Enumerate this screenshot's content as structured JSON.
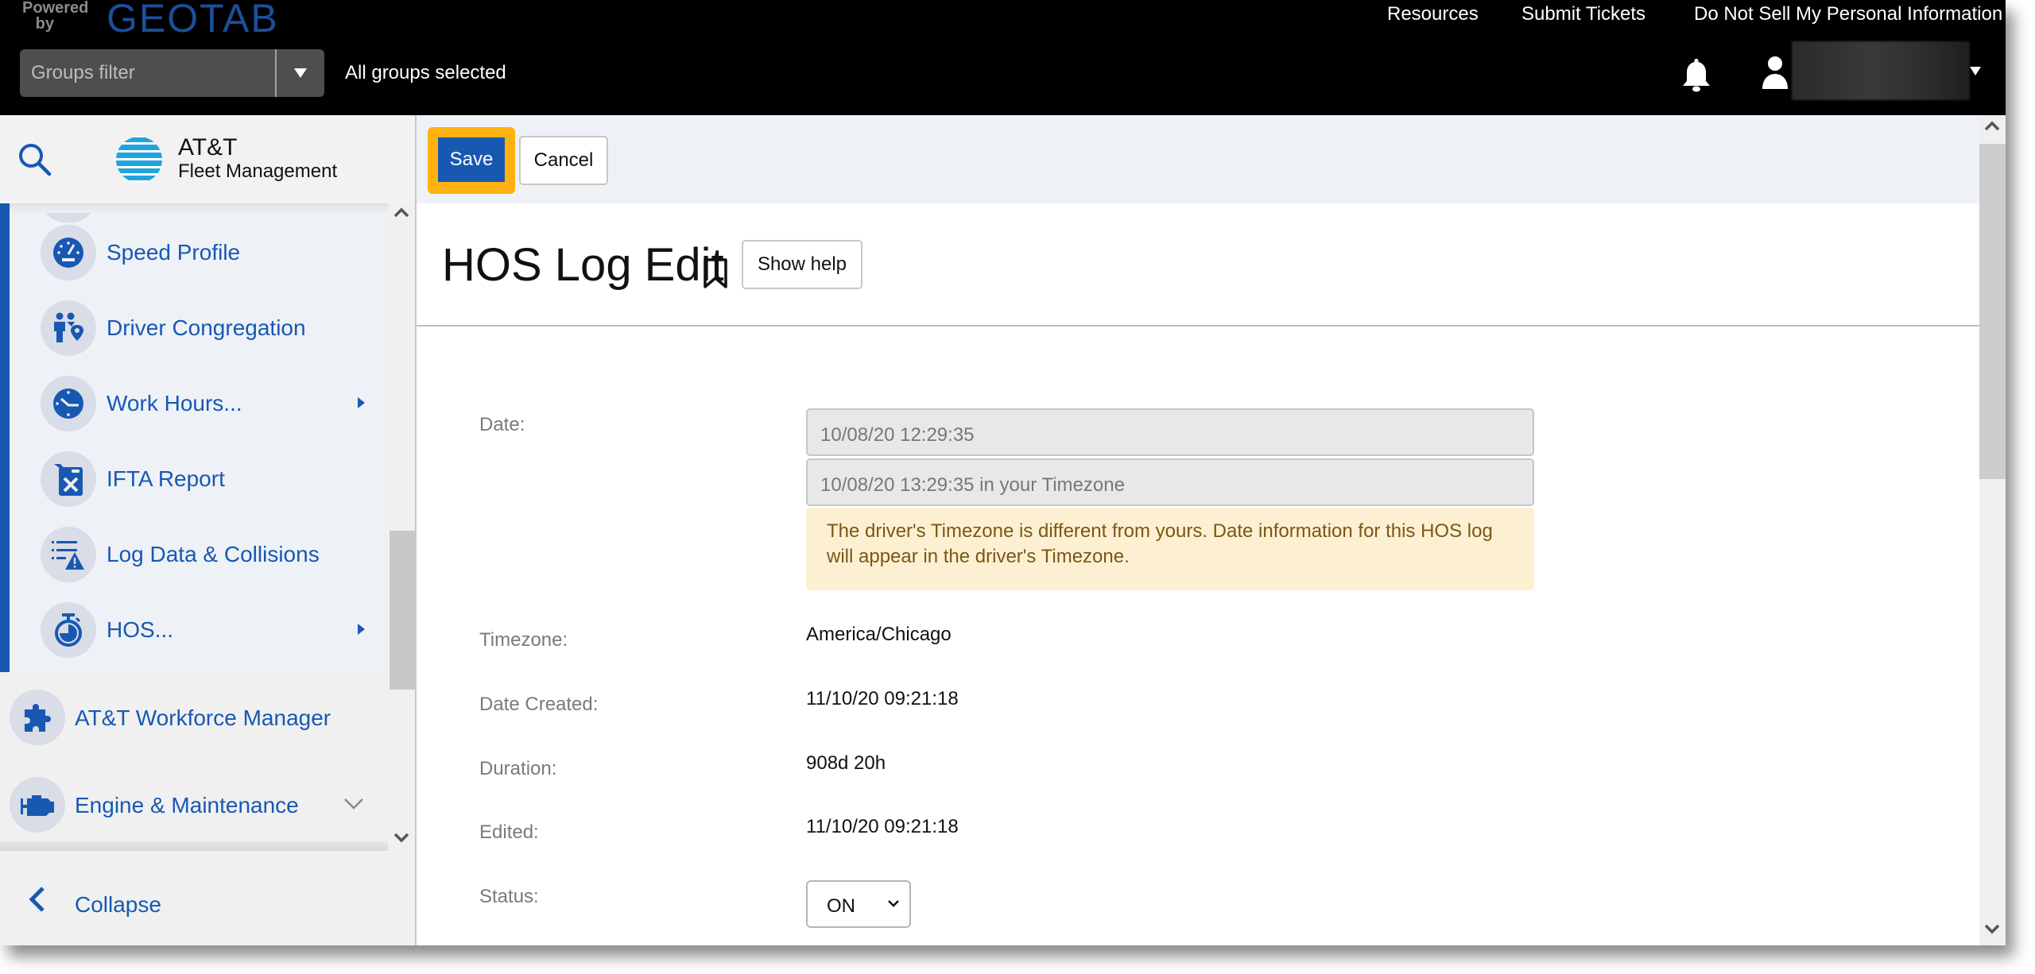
{
  "header": {
    "powered_by": "Powered by",
    "brand": "GEOTAB",
    "links": [
      "Resources",
      "Submit Tickets",
      "Do Not Sell My Personal Information"
    ],
    "groups_filter": {
      "placeholder": "Groups filter",
      "selection": "All groups selected"
    },
    "icons": {
      "notifications": "bell-icon",
      "user": "user-icon",
      "menu": "caret-down-icon"
    }
  },
  "sidebar": {
    "logo": {
      "name": "AT&T",
      "subtitle": "Fleet Management"
    },
    "submenu_items": [
      {
        "label": "Speed Profile",
        "icon": "speedometer-icon",
        "has_submenu": false
      },
      {
        "label": "Driver Congregation",
        "icon": "driver-congregation-icon",
        "has_submenu": false
      },
      {
        "label": "Work Hours...",
        "icon": "clock-icon",
        "has_submenu": true
      },
      {
        "label": "IFTA Report",
        "icon": "fuel-can-icon",
        "has_submenu": false
      },
      {
        "label": "Log Data & Collisions",
        "icon": "log-warning-icon",
        "has_submenu": false
      },
      {
        "label": "HOS...",
        "icon": "stopwatch-icon",
        "has_submenu": true
      }
    ],
    "main_items": [
      {
        "label": "AT&T Workforce Manager",
        "icon": "puzzle-icon"
      },
      {
        "label": "Engine & Maintenance",
        "icon": "engine-icon",
        "expandable": true
      }
    ],
    "collapse_label": "Collapse",
    "accent_color": "#1858b3"
  },
  "toolbar": {
    "save_label": "Save",
    "cancel_label": "Cancel",
    "highlight_color": "#ffb20f"
  },
  "page": {
    "title": "HOS Log Edit",
    "show_help_label": "Show help"
  },
  "form": {
    "date": {
      "label": "Date:",
      "value": "10/08/20 12:29:35",
      "local_value": "10/08/20 13:29:35 in your Timezone",
      "warning": "The driver's Timezone is different from yours. Date information for this HOS log will appear in the driver's Timezone."
    },
    "timezone": {
      "label": "Timezone:",
      "value": "America/Chicago"
    },
    "date_created": {
      "label": "Date Created:",
      "value": "11/10/20 09:21:18"
    },
    "duration": {
      "label": "Duration:",
      "value": "908d 20h"
    },
    "edited": {
      "label": "Edited:",
      "value": "11/10/20 09:21:18"
    },
    "status": {
      "label": "Status:",
      "value": "ON"
    }
  }
}
